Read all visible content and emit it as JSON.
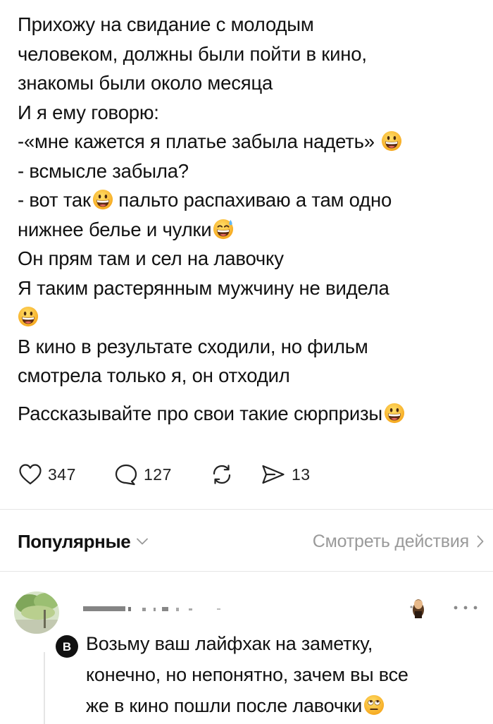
{
  "post": {
    "lines": [
      "Прихожу на свидание с молодым",
      "человеком, должны были пойти в кино,",
      "знакомы были около месяца",
      "И я ему говорю:",
      "-«мне кажется я платье забыла надеть»",
      "- всмысле забыла?",
      "- вот так",
      "пальто распахиваю а там одно",
      "нижнее белье и чулки",
      "Он прям там и сел на лавочку",
      "Я таким растерянным мужчину не видела",
      "В кино в результате сходили, но фильм",
      "смотрела только я, он отходил",
      "Рассказывайте про свои такие сюрпризы"
    ],
    "emojis": {
      "grin": "grinning-face-emoji",
      "sweat": "grinning-sweat-emoji"
    }
  },
  "actions": {
    "likes": "347",
    "comments": "127",
    "shares": "13"
  },
  "comments_header": {
    "sort_label": "Популярные",
    "view_actions_label": "Смотреть действия"
  },
  "comment": {
    "text_lines": [
      "Возьму ваш лайфхак на заметку,",
      "конечно, но непонятно, зачем вы все",
      "же в кино пошли после лавочки"
    ],
    "reply_to_letter": "В"
  },
  "colors": {
    "text": "#111111",
    "muted": "#9a9a9a",
    "divider": "#e6e6e6",
    "emoji_yellow": "#ffc928"
  }
}
